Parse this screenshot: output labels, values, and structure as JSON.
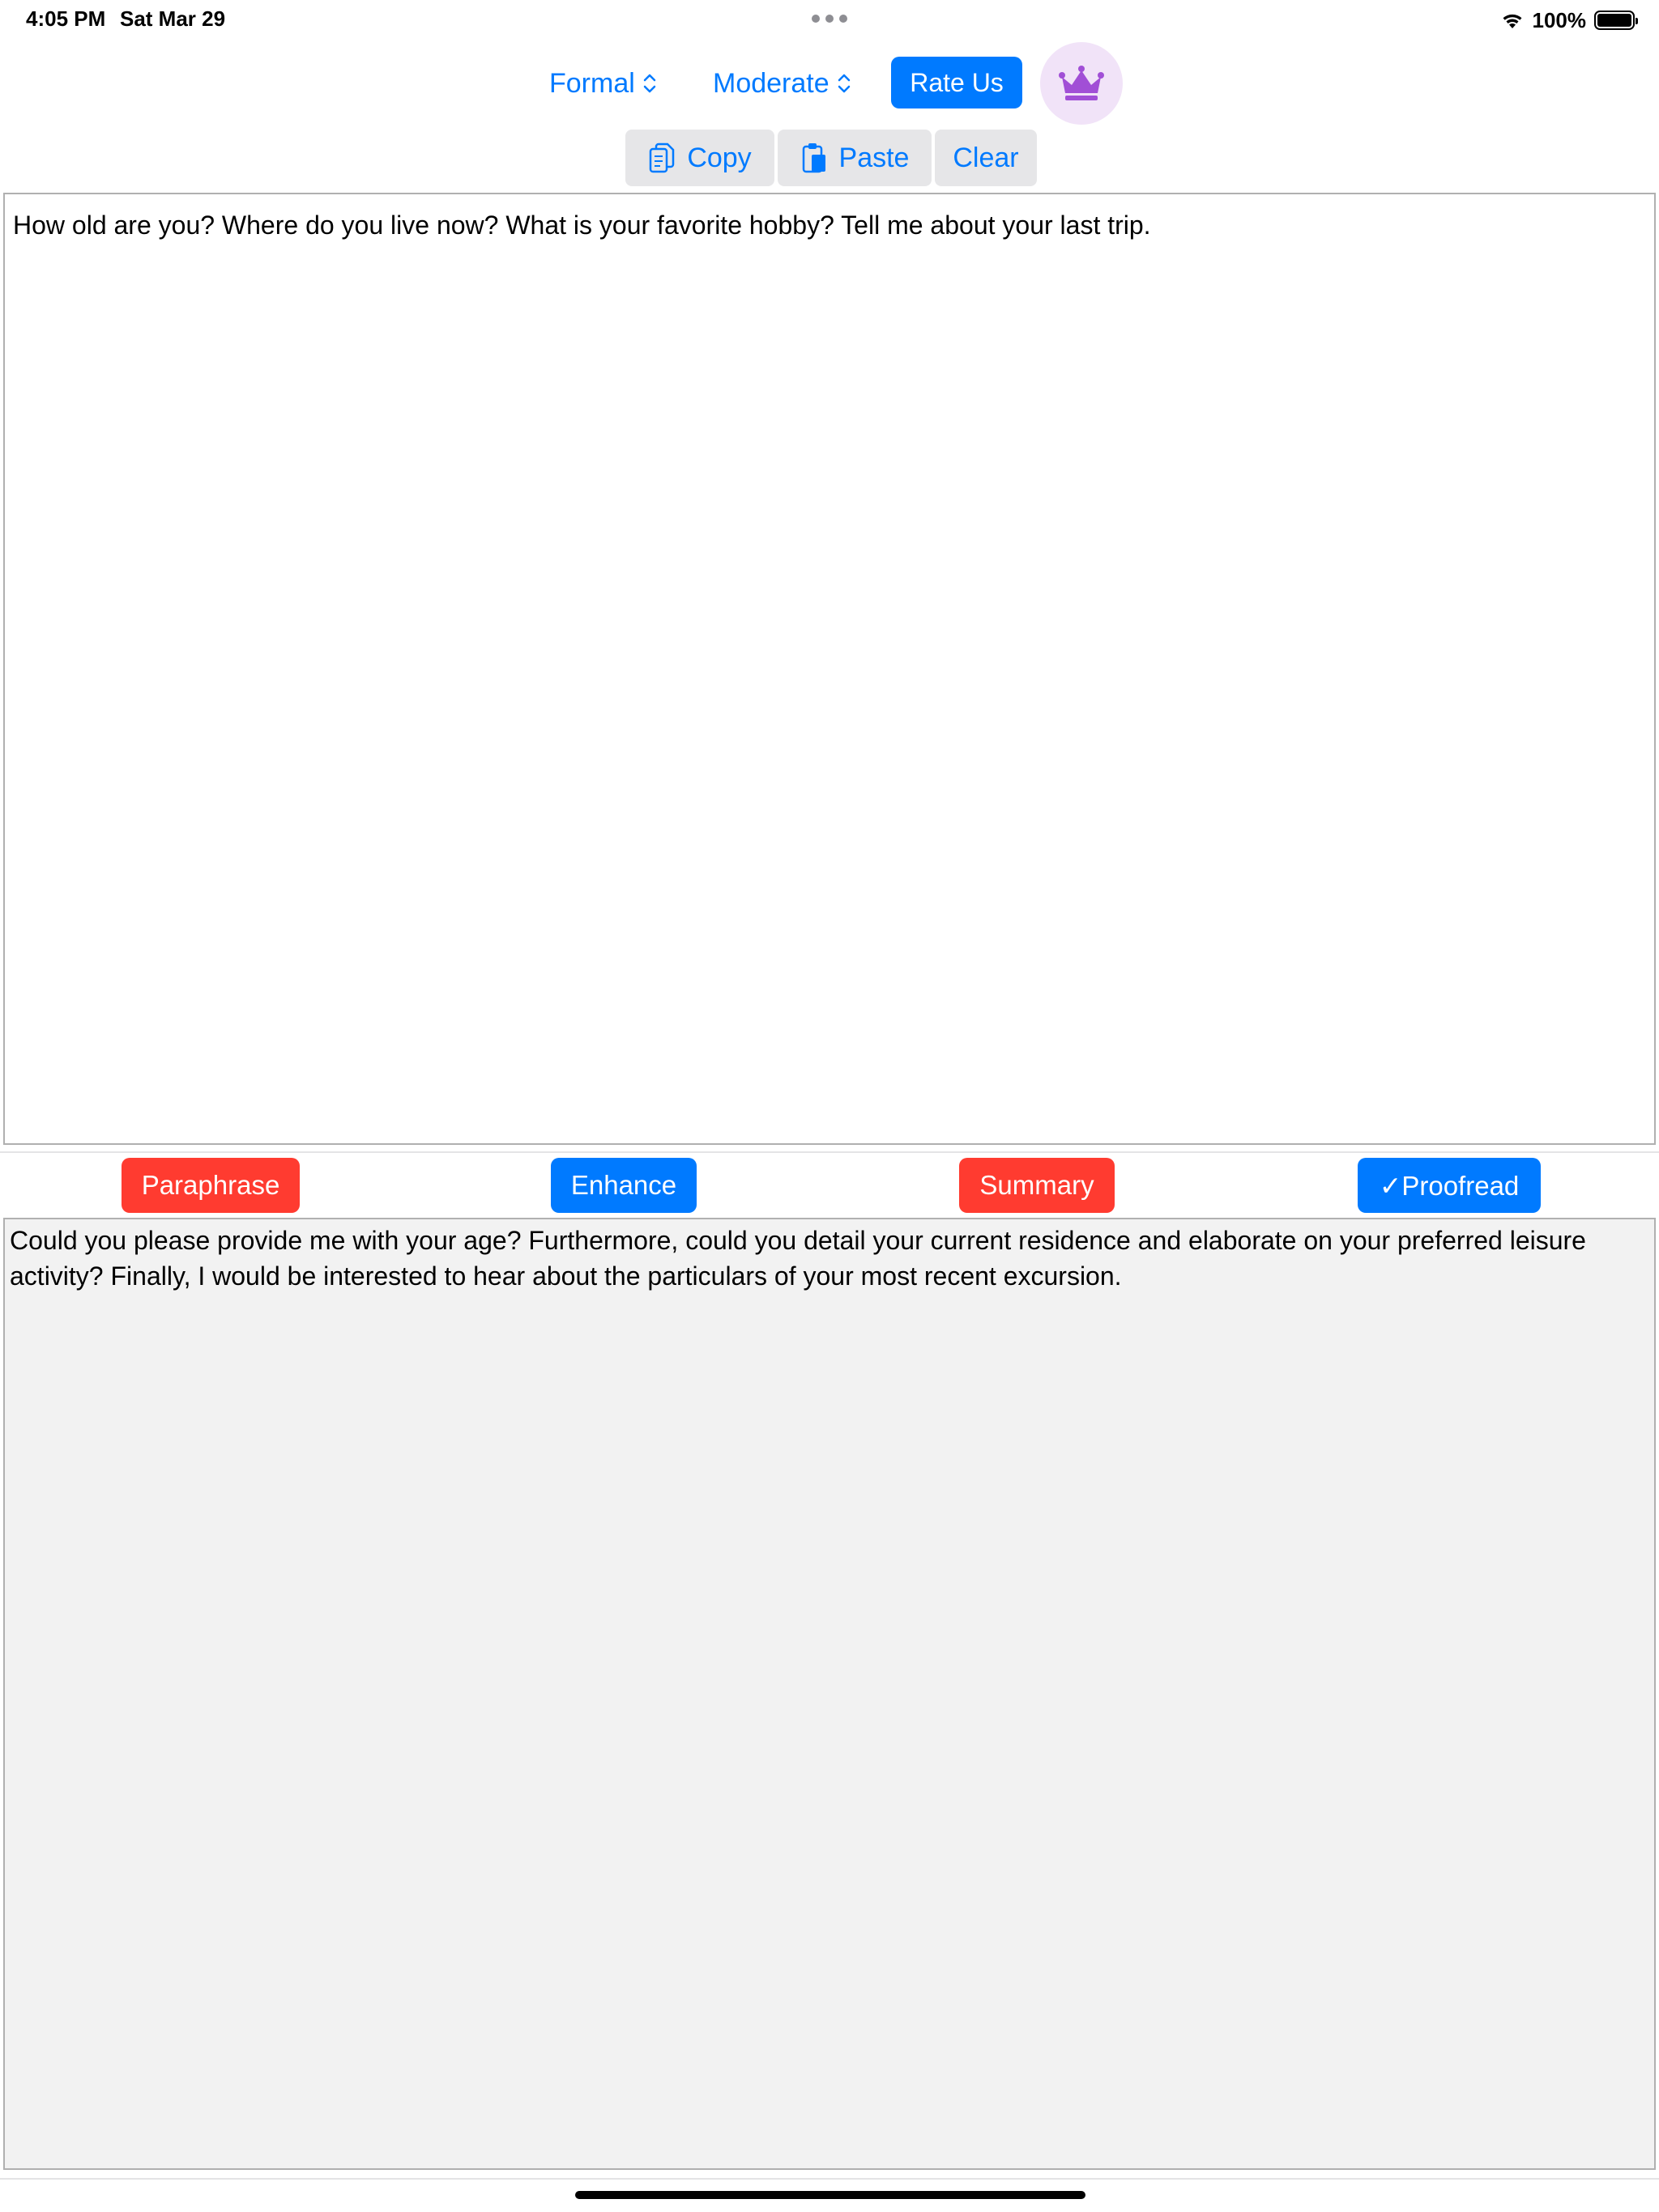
{
  "status_bar": {
    "time": "4:05 PM",
    "date": "Sat Mar 29",
    "battery": "100%"
  },
  "toolbar": {
    "tone_picker": "Formal",
    "level_picker": "Moderate",
    "rate_label": "Rate Us"
  },
  "edit_buttons": {
    "copy_label": "Copy",
    "paste_label": "Paste",
    "clear_label": "Clear"
  },
  "input": {
    "text": "How old are you? Where do you live now? What is your favorite hobby? Tell me about your last trip."
  },
  "actions": {
    "paraphrase_label": "Paraphrase",
    "enhance_label": "Enhance",
    "summary_label": "Summary",
    "proofread_label": "✓Proofread"
  },
  "output": {
    "text": "Could you please provide me with your age? Furthermore, could you detail your current residence and elaborate on your preferred leisure activity? Finally, I would be interested to hear about the particulars of your most recent excursion."
  },
  "colors": {
    "accent_blue": "#007aff",
    "accent_red": "#ff3b30",
    "crown_purple": "#a14fd6"
  }
}
